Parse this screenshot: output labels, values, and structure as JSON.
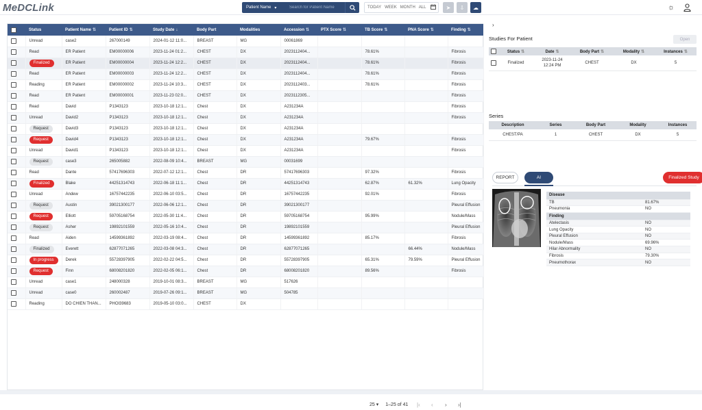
{
  "app": {
    "logo": "MeDCLink"
  },
  "search": {
    "type_label": "Patient Name",
    "placeholder": "Search for Patient Name"
  },
  "date_filter": {
    "today": "TODAY",
    "week": "WEEK",
    "month": "MONTH",
    "all": "ALL"
  },
  "columns": [
    "Status",
    "Patient Name",
    "Patient ID",
    "Study Date",
    "Body Part",
    "Modalities",
    "Accession",
    "PTX Score",
    "TB Score",
    "PNA Score",
    "Finding"
  ],
  "studies": [
    {
      "status": "Unread",
      "chip": "",
      "name": "case2",
      "pid": "267000149",
      "date": "2024-01-12 11:0...",
      "body": "BREAST",
      "mod": "MG",
      "acc": "00061869",
      "ptx": "",
      "tb": "",
      "pna": "",
      "finding": ""
    },
    {
      "status": "Read",
      "chip": "",
      "name": "ER Patient",
      "pid": "EM00000006",
      "date": "2023-11-24 01:2...",
      "body": "CHEST",
      "mod": "DX",
      "acc": "2023112404...",
      "ptx": "",
      "tb": "78.61%",
      "pna": "",
      "finding": "Fibrosis"
    },
    {
      "status": "Finalized",
      "chip": "red",
      "name": "ER Patient",
      "pid": "EM00000004",
      "date": "2023-11-24 12:2...",
      "body": "CHEST",
      "mod": "DX",
      "acc": "2023112404...",
      "ptx": "",
      "tb": "78.61%",
      "pna": "",
      "finding": "Fibrosis"
    },
    {
      "status": "Read",
      "chip": "",
      "name": "ER Patient",
      "pid": "EM00000003",
      "date": "2023-11-24 12:2...",
      "body": "CHEST",
      "mod": "DX",
      "acc": "2023112404...",
      "ptx": "",
      "tb": "78.61%",
      "pna": "",
      "finding": "Fibrosis"
    },
    {
      "status": "Reading",
      "chip": "",
      "name": "ER Patient",
      "pid": "EM00000002",
      "date": "2023-11-24 10:3...",
      "body": "CHEST",
      "mod": "DX",
      "acc": "2023112403...",
      "ptx": "",
      "tb": "78.61%",
      "pna": "",
      "finding": "Fibrosis"
    },
    {
      "status": "Read",
      "chip": "",
      "name": "ER Patient",
      "pid": "EM00000001",
      "date": "2023-11-23 02:0...",
      "body": "CHEST",
      "mod": "DX",
      "acc": "2023112305...",
      "ptx": "",
      "tb": "",
      "pna": "",
      "finding": "Fibrosis"
    },
    {
      "status": "Read",
      "chip": "",
      "name": "David",
      "pid": "P1343123",
      "date": "2023-10-18 12:1...",
      "body": "Chest",
      "mod": "DX",
      "acc": "A231234A",
      "ptx": "",
      "tb": "",
      "pna": "",
      "finding": "Fibrosis"
    },
    {
      "status": "Unread",
      "chip": "",
      "name": "David2",
      "pid": "P1343123",
      "date": "2023-10-18 12:1...",
      "body": "Chest",
      "mod": "DX",
      "acc": "A231234A",
      "ptx": "",
      "tb": "",
      "pna": "",
      "finding": "Fibrosis"
    },
    {
      "status": "Request",
      "chip": "grey",
      "name": "David3",
      "pid": "P1343123",
      "date": "2023-10-18 12:1...",
      "body": "Chest",
      "mod": "DX",
      "acc": "A231234A",
      "ptx": "",
      "tb": "",
      "pna": "",
      "finding": ""
    },
    {
      "status": "Request",
      "chip": "red",
      "name": "David4",
      "pid": "P1343123",
      "date": "2023-10-18 12:1...",
      "body": "Chest",
      "mod": "DX",
      "acc": "A231234A",
      "ptx": "",
      "tb": "79.67%",
      "pna": "",
      "finding": "Fibrosis"
    },
    {
      "status": "Unread",
      "chip": "",
      "name": "David1",
      "pid": "P1343123",
      "date": "2023-10-18 12:1...",
      "body": "Chest",
      "mod": "DX",
      "acc": "A231234A",
      "ptx": "",
      "tb": "",
      "pna": "",
      "finding": "Fibrosis"
    },
    {
      "status": "Request",
      "chip": "grey",
      "name": "case3",
      "pid": "265005882",
      "date": "2022-08-09 10:4...",
      "body": "BREAST",
      "mod": "MG",
      "acc": "00031699",
      "ptx": "",
      "tb": "",
      "pna": "",
      "finding": ""
    },
    {
      "status": "Read",
      "chip": "",
      "name": "Dante",
      "pid": "57417696303",
      "date": "2022-07-12 12:1...",
      "body": "Chest",
      "mod": "DR",
      "acc": "57417696303",
      "ptx": "",
      "tb": "97.32%",
      "pna": "",
      "finding": "Fibrosis"
    },
    {
      "status": "Finalized",
      "chip": "red",
      "name": "Blake",
      "pid": "44251314743",
      "date": "2022-06-18 11:1...",
      "body": "Chest",
      "mod": "DR",
      "acc": "44251314743",
      "ptx": "",
      "tb": "62.87%",
      "pna": "61.32%",
      "finding": "Lung Opacity"
    },
    {
      "status": "Unread",
      "chip": "",
      "name": "Andew",
      "pid": "16757442235",
      "date": "2022-06-10 03:5...",
      "body": "Chest",
      "mod": "DR",
      "acc": "16757442235",
      "ptx": "",
      "tb": "92.01%",
      "pna": "",
      "finding": "Fibrosis"
    },
    {
      "status": "Request",
      "chip": "grey",
      "name": "Austin",
      "pid": "39021300177",
      "date": "2022-06-06 12:1...",
      "body": "Chest",
      "mod": "DR",
      "acc": "39021300177",
      "ptx": "",
      "tb": "",
      "pna": "",
      "finding": "Pleural Effusion"
    },
    {
      "status": "Request",
      "chip": "red",
      "name": "Elliott",
      "pid": "59705168754",
      "date": "2022-05-30 11:4...",
      "body": "Chest",
      "mod": "DR",
      "acc": "59705168754",
      "ptx": "",
      "tb": "95.99%",
      "pna": "",
      "finding": "Nodule/Mass"
    },
    {
      "status": "Request",
      "chip": "grey",
      "name": "Asher",
      "pid": "19892101559",
      "date": "2022-05-16 10:4...",
      "body": "Chest",
      "mod": "DR",
      "acc": "19892101559",
      "ptx": "",
      "tb": "",
      "pna": "",
      "finding": "Pleural Effusion"
    },
    {
      "status": "Read",
      "chip": "",
      "name": "Aiden",
      "pid": "14599361892",
      "date": "2022-03-19 08:4...",
      "body": "Chest",
      "mod": "DR",
      "acc": "14599361892",
      "ptx": "",
      "tb": "85.17%",
      "pna": "",
      "finding": "Fibrosis"
    },
    {
      "status": "Finalized",
      "chip": "grey",
      "name": "Everett",
      "pid": "62877071265",
      "date": "2022-03-08 04:3...",
      "body": "Chest",
      "mod": "DR",
      "acc": "62877071265",
      "ptx": "",
      "tb": "",
      "pna": "66.44%",
      "finding": "Nodule/Mass"
    },
    {
      "status": "In progress",
      "chip": "red",
      "name": "Derek",
      "pid": "55728397905",
      "date": "2022-02-22 04:5...",
      "body": "Chest",
      "mod": "DR",
      "acc": "55728397905",
      "ptx": "",
      "tb": "65.31%",
      "pna": "79.59%",
      "finding": "Pleural Effusion"
    },
    {
      "status": "Request",
      "chip": "red",
      "name": "Finn",
      "pid": "68008201820",
      "date": "2022-02-05 06:1...",
      "body": "Chest",
      "mod": "DR",
      "acc": "68008201820",
      "ptx": "",
      "tb": "89.56%",
      "pna": "",
      "finding": "Fibrosis"
    },
    {
      "status": "Unread",
      "chip": "",
      "name": "case1",
      "pid": "248000328",
      "date": "2019-10-01 08:3...",
      "body": "BREAST",
      "mod": "MG",
      "acc": "517626",
      "ptx": "",
      "tb": "",
      "pna": "",
      "finding": ""
    },
    {
      "status": "Unread",
      "chip": "",
      "name": "case0",
      "pid": "260002487",
      "date": "2019-07-26 09:1...",
      "body": "BREAST",
      "mod": "MG",
      "acc": "504785",
      "ptx": "",
      "tb": "",
      "pna": "",
      "finding": ""
    },
    {
      "status": "Reading",
      "chip": "",
      "name": "DO CHIEN THAN...",
      "pid": "PHOI39683",
      "date": "2019-05-10 03:0...",
      "body": "CHEST",
      "mod": "DX",
      "acc": "",
      "ptx": "",
      "tb": "",
      "pna": "",
      "finding": ""
    }
  ],
  "pagination": {
    "per_page": "25",
    "range": "1–25 of 41"
  },
  "right": {
    "studies_title": "Studies For Patient",
    "open_label": "Open",
    "studies_columns": [
      "Status",
      "Date",
      "Body Part",
      "Modality",
      "Instances"
    ],
    "study_row": {
      "status": "Finalized",
      "date1": "2023-11-24",
      "date2": "12:24 PM",
      "body": "CHEST",
      "mod": "DX",
      "instances": "5"
    },
    "series_title": "Series",
    "series_columns": [
      "Description",
      "Series",
      "Body Part",
      "Modality",
      "Instances"
    ],
    "series_row": {
      "desc": "CHEST/PA",
      "series": "1",
      "body": "CHEST",
      "mod": "DX",
      "instances": "5"
    },
    "tab_report": "REPORT",
    "tab_ai": "AI",
    "finalized_button": "Finalized Study",
    "ai_results": [
      {
        "kind": "head",
        "label": "Disease",
        "value": ""
      },
      {
        "kind": "row",
        "label": "TB",
        "value": "81.67%"
      },
      {
        "kind": "row",
        "label": "Pneumonia",
        "value": "NO"
      },
      {
        "kind": "head",
        "label": "Finding",
        "value": ""
      },
      {
        "kind": "row",
        "label": "Atelectasis",
        "value": "NO"
      },
      {
        "kind": "row",
        "label": "Lung Opacity",
        "value": "NO"
      },
      {
        "kind": "row",
        "label": "Pleural Effusion",
        "value": "NO"
      },
      {
        "kind": "row",
        "label": "Nodule/Mass",
        "value": "69.96%"
      },
      {
        "kind": "row",
        "label": "Hilar Abnormality",
        "value": "NO"
      },
      {
        "kind": "row",
        "label": "Fibrosis",
        "value": "79.30%"
      },
      {
        "kind": "row",
        "label": "Pneumothorax",
        "value": "NO"
      }
    ]
  },
  "colors": {
    "header": "#3d5a8a",
    "accent": "#2f4a75",
    "danger": "#e02f2f"
  }
}
